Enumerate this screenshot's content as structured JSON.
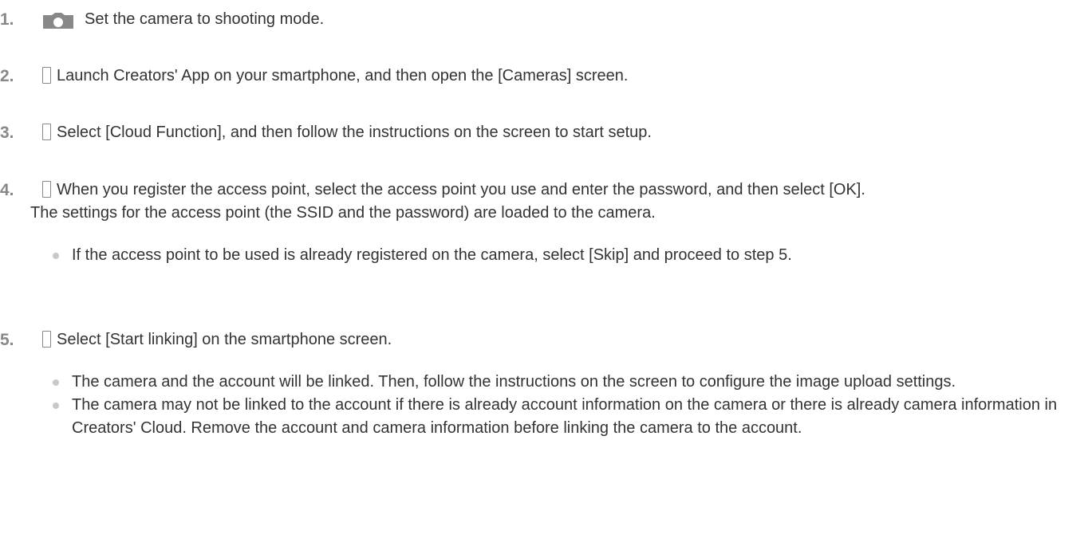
{
  "steps": [
    {
      "number": "1.",
      "icon": "camera-icon",
      "text": "Set the camera to shooting mode."
    },
    {
      "number": "2.",
      "icon": "smartphone-icon",
      "text": "Launch Creators' App on your smartphone, and then open the [Cameras] screen."
    },
    {
      "number": "3.",
      "icon": "smartphone-icon",
      "text": "Select [Cloud Function], and then follow the instructions on the screen to start setup."
    },
    {
      "number": "4.",
      "icon": "smartphone-icon",
      "text": "When you register the access point, select the access point you use and enter the password, and then select [OK].",
      "paragraph": "The settings for the access point (the SSID and the password) are loaded to the camera.",
      "bullets": [
        "If the access point to be used is already registered on the camera, select [Skip] and proceed to step 5."
      ]
    },
    {
      "number": "5.",
      "icon": "smartphone-icon",
      "text": "Select [Start linking] on the smartphone screen.",
      "bullets": [
        "The camera and the account will be linked. Then, follow the instructions on the screen to configure the image upload settings.",
        "The camera may not be linked to the account if there is already account information on the camera or there is already camera information in Creators' Cloud. Remove the account and camera information before linking the camera to the account."
      ]
    }
  ],
  "colors": {
    "text": "#333333",
    "step_number": "#888888",
    "icon": "#888888",
    "bullet": "#c8c8c8"
  }
}
